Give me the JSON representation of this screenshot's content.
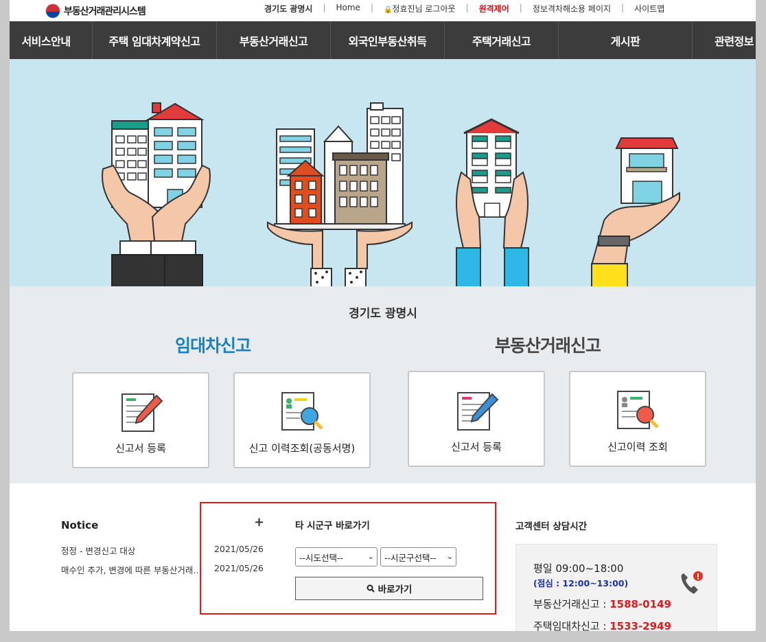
{
  "header": {
    "logo_text": "부동산거래관리시스템",
    "util_links": [
      "경기도 광명시",
      "Home",
      "정효진님 로그아웃",
      "원격제어",
      "정보격차해소용 페이지",
      "사이트맵"
    ]
  },
  "nav": {
    "items": [
      "서비스안내",
      "주택 임대차계약신고",
      "부동산거래신고",
      "외국인부동산취득",
      "주택거래신고",
      "게시판",
      "관련정보"
    ]
  },
  "main": {
    "region": "경기도 광명시",
    "lease_category": "임대차신고",
    "trade_category": "부동산거래신고",
    "cards": [
      "신고서 등록",
      "신고 이력조회(공동서명)",
      "신고서 등록",
      "신고이력 조회"
    ]
  },
  "notice": {
    "title": "Notice",
    "more": "+",
    "items": [
      {
        "title": "정정 - 변경신고 대상",
        "date": "2021/05/26"
      },
      {
        "title": "매수인 추가, 변경에 따른 부동산거래신고",
        "date": "2021/05/26"
      }
    ]
  },
  "shortcut": {
    "title": "타 시군구 바로가기",
    "sido_select": "--시도선택--",
    "sigungu_select": "--시군구선택--",
    "go_button": "바로가기"
  },
  "support": {
    "title": "고객센터 상담시간",
    "weekday": "평일 09:00~18:00",
    "lunch": "(점심 : 12:00~13:00)",
    "trade_label": "부동산거래신고 : ",
    "trade_phone": "1588-0149",
    "lease_label": "주택임대차신고 : ",
    "lease_phone": "1533-2949"
  },
  "colors": {
    "nav_bg": "#3c3c3c",
    "hero_bg": "#c8e6ef",
    "lease_blue": "#1a7fc4",
    "highlight_red": "#e01b1b"
  }
}
